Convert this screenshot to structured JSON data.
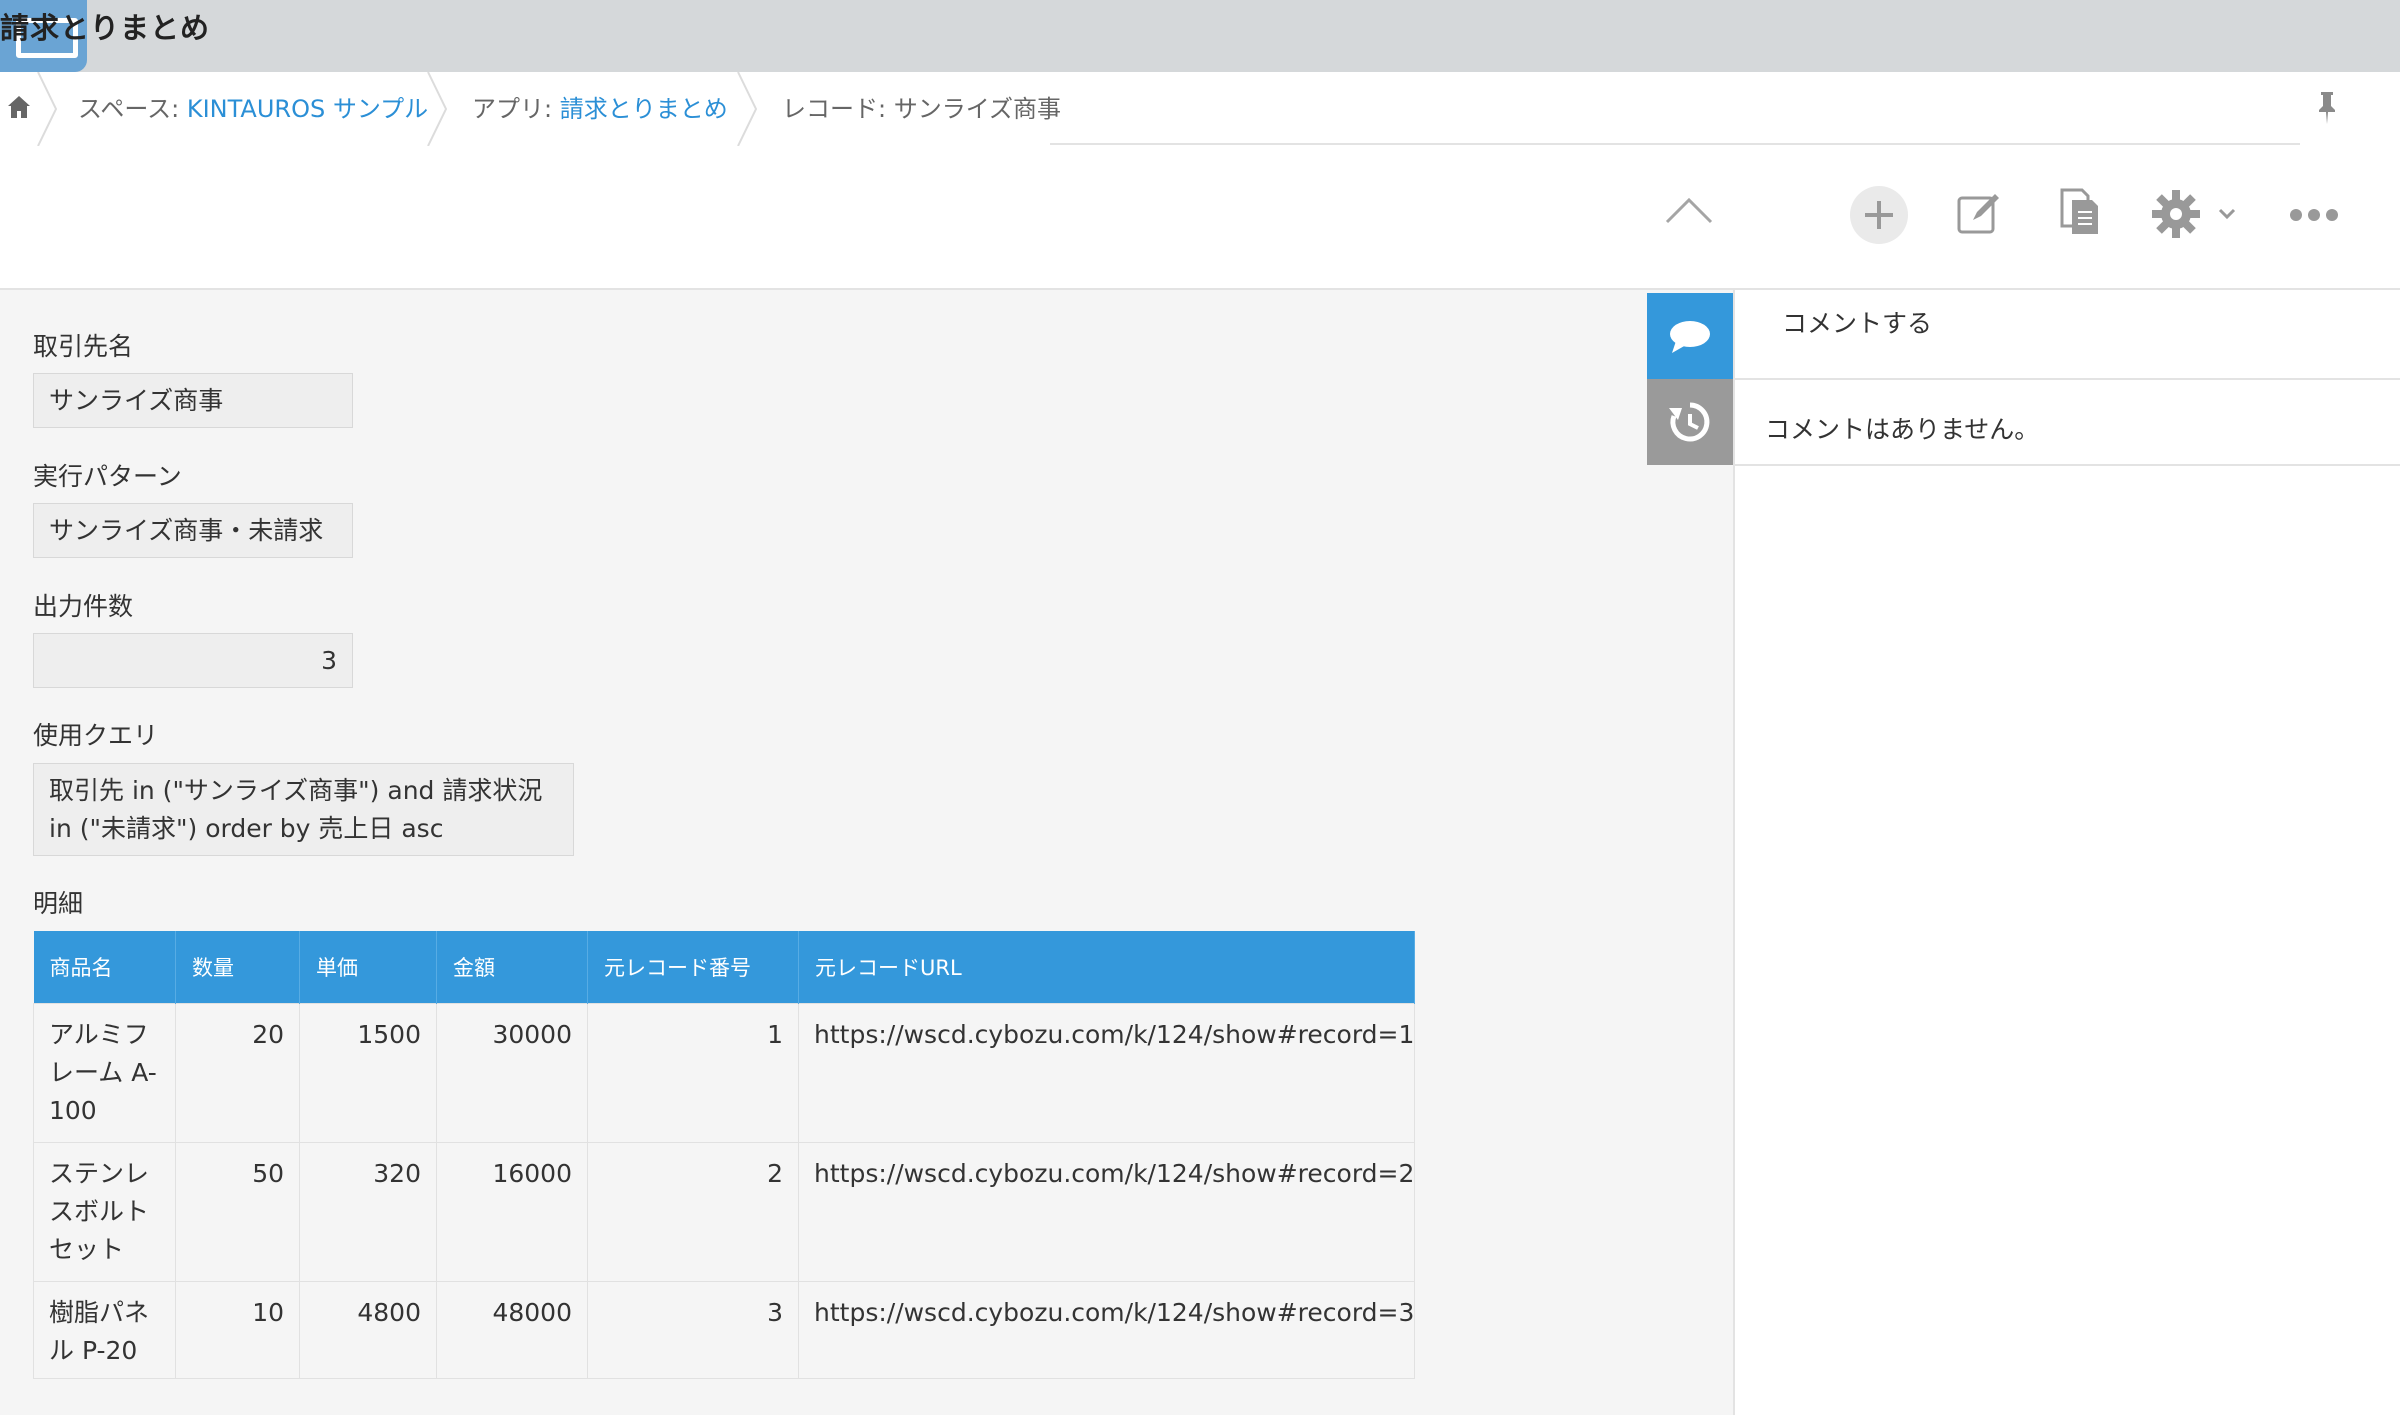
{
  "app": {
    "title": "請求とりまとめ"
  },
  "breadcrumb": {
    "space_prefix": "スペース: ",
    "space_name": "KINTAUROS サンプル",
    "app_prefix": "アプリ: ",
    "app_name": "請求とりまとめ",
    "record_label": "レコード: サンライズ商事"
  },
  "toolbar": {
    "icons": [
      "chevron-up-icon",
      "plus-icon",
      "edit-icon",
      "copy-icon",
      "gear-icon",
      "chevron-down-icon",
      "more-icon"
    ]
  },
  "fields": {
    "client_label": "取引先名",
    "client_value": "サンライズ商事",
    "pattern_label": "実行パターン",
    "pattern_value": "サンライズ商事・未請求",
    "count_label": "出力件数",
    "count_value": "3",
    "query_label": "使用クエリ",
    "query_value": "取引先 in (\"サンライズ商事\") and 請求状況 in (\"未請求\") order by 売上日 asc",
    "details_label": "明細"
  },
  "table": {
    "headers": [
      "商品名",
      "数量",
      "単価",
      "金額",
      "元レコード番号",
      "元レコードURL"
    ],
    "rows": [
      [
        "アルミフレーム A-100",
        "20",
        "1500",
        "30000",
        "1",
        "https://wscd.cybozu.com/k/124/show#record=1"
      ],
      [
        "ステンレスボルトセット",
        "50",
        "320",
        "16000",
        "2",
        "https://wscd.cybozu.com/k/124/show#record=2"
      ],
      [
        "樹脂パネル P-20",
        "10",
        "4800",
        "48000",
        "3",
        "https://wscd.cybozu.com/k/124/show#record=3"
      ]
    ]
  },
  "side_panel": {
    "comment_placeholder": "コメントする",
    "no_comments": "コメントはありません。"
  },
  "colors": {
    "accent": "#3498db",
    "link": "#2b8fd6",
    "header_bg": "#d5d8da"
  }
}
